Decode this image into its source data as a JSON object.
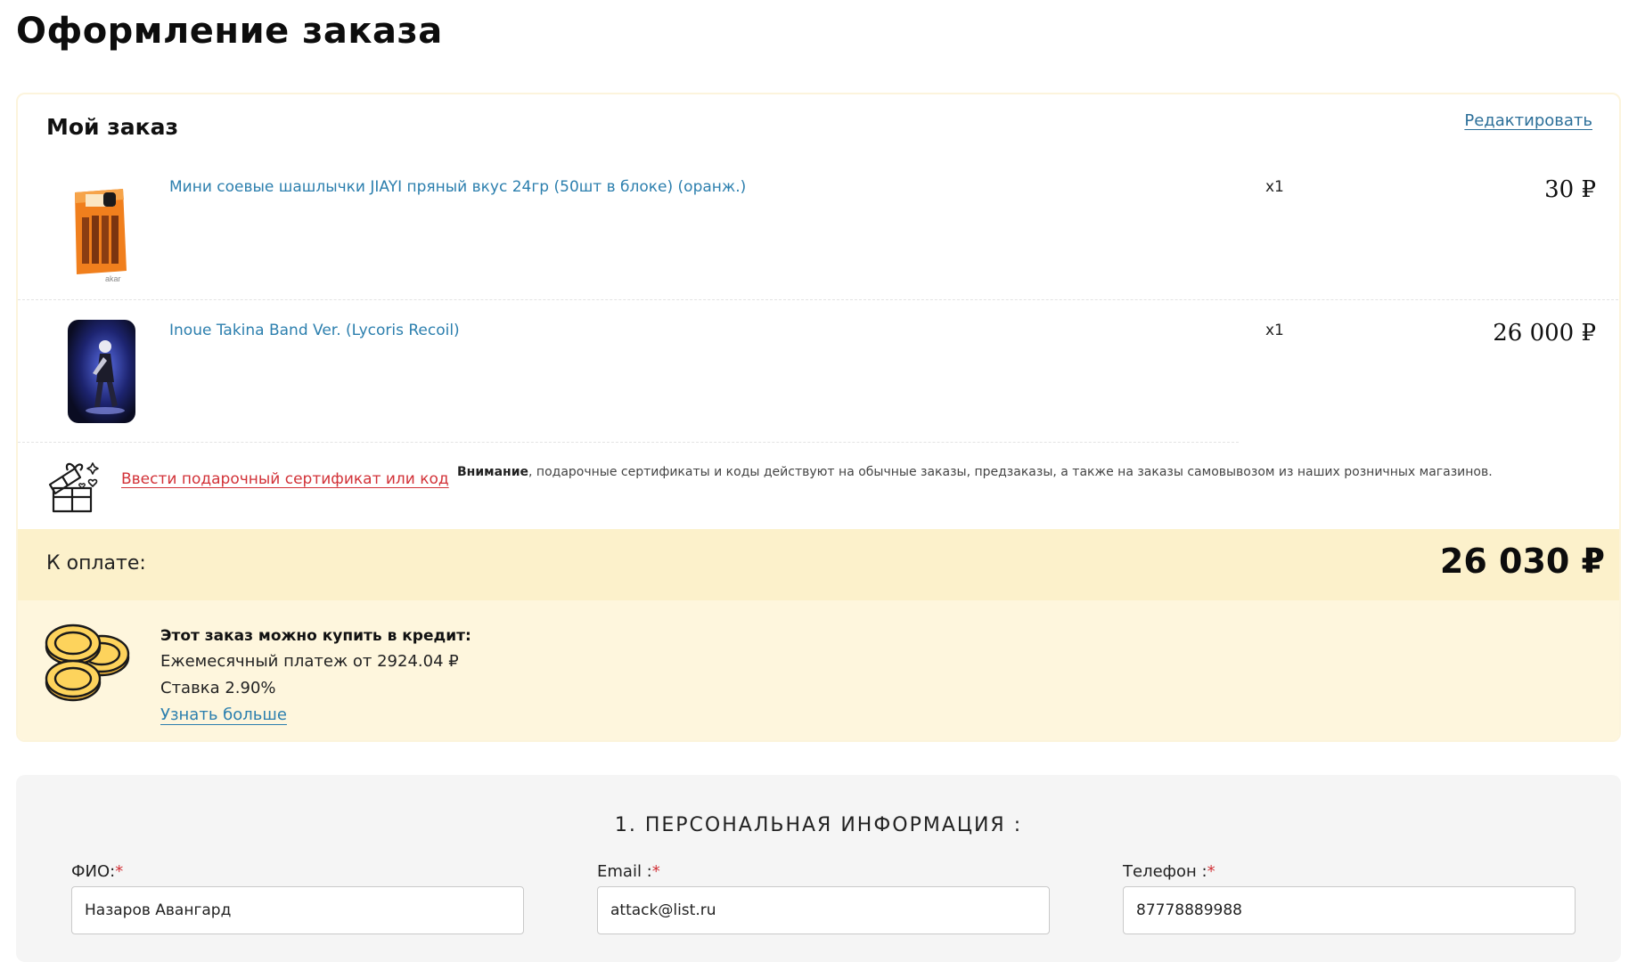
{
  "page_title": "Оформление заказа",
  "order": {
    "header": "Мой заказ",
    "edit_label": "Редактировать",
    "items": [
      {
        "name": "Мини соевые шашлычки JIAYI пряный вкус 24гр (50шт в блоке) (оранж.)",
        "qty": "x1",
        "price": "30 ₽",
        "thumb": "snack-package-image"
      },
      {
        "name": "Inoue Takina Band Ver. (Lycoris Recoil)",
        "qty": "x1",
        "price": "26 000 ₽",
        "thumb": "figure-image"
      }
    ],
    "certificate": {
      "link_label": "Ввести подарочный сертификат или код",
      "note_bold": "Внимание",
      "note_text": ", подарочные сертификаты и коды действуют на обычные заказы, предзаказы, а также на заказы самовывозом из наших розничных магазинов.",
      "icon": "gift-box-icon"
    },
    "total": {
      "label": "К оплате:",
      "amount": "26 030 ₽"
    },
    "credit": {
      "icon": "coins-icon",
      "title": "Этот заказ можно купить в кредит:",
      "monthly": "Ежемесячный платеж от 2924.04 ₽",
      "rate": "Ставка 2.90%",
      "more_label": "Узнать больше"
    }
  },
  "personal": {
    "title": "1. ПЕРСОНАЛЬНАЯ ИНФОРМАЦИЯ :",
    "fields": [
      {
        "label": "ФИО:",
        "required_mark": "*",
        "value": "Назаров Авангард"
      },
      {
        "label": "Email :",
        "required_mark": "*",
        "value": "attack@list.ru"
      },
      {
        "label": "Телефон :",
        "required_mark": "*",
        "value": "87778889988"
      }
    ]
  },
  "colors": {
    "link_blue": "#2c7fae",
    "link_red": "#d23238",
    "total_bg": "#fcf1cb",
    "credit_bg": "#fef6dd"
  }
}
